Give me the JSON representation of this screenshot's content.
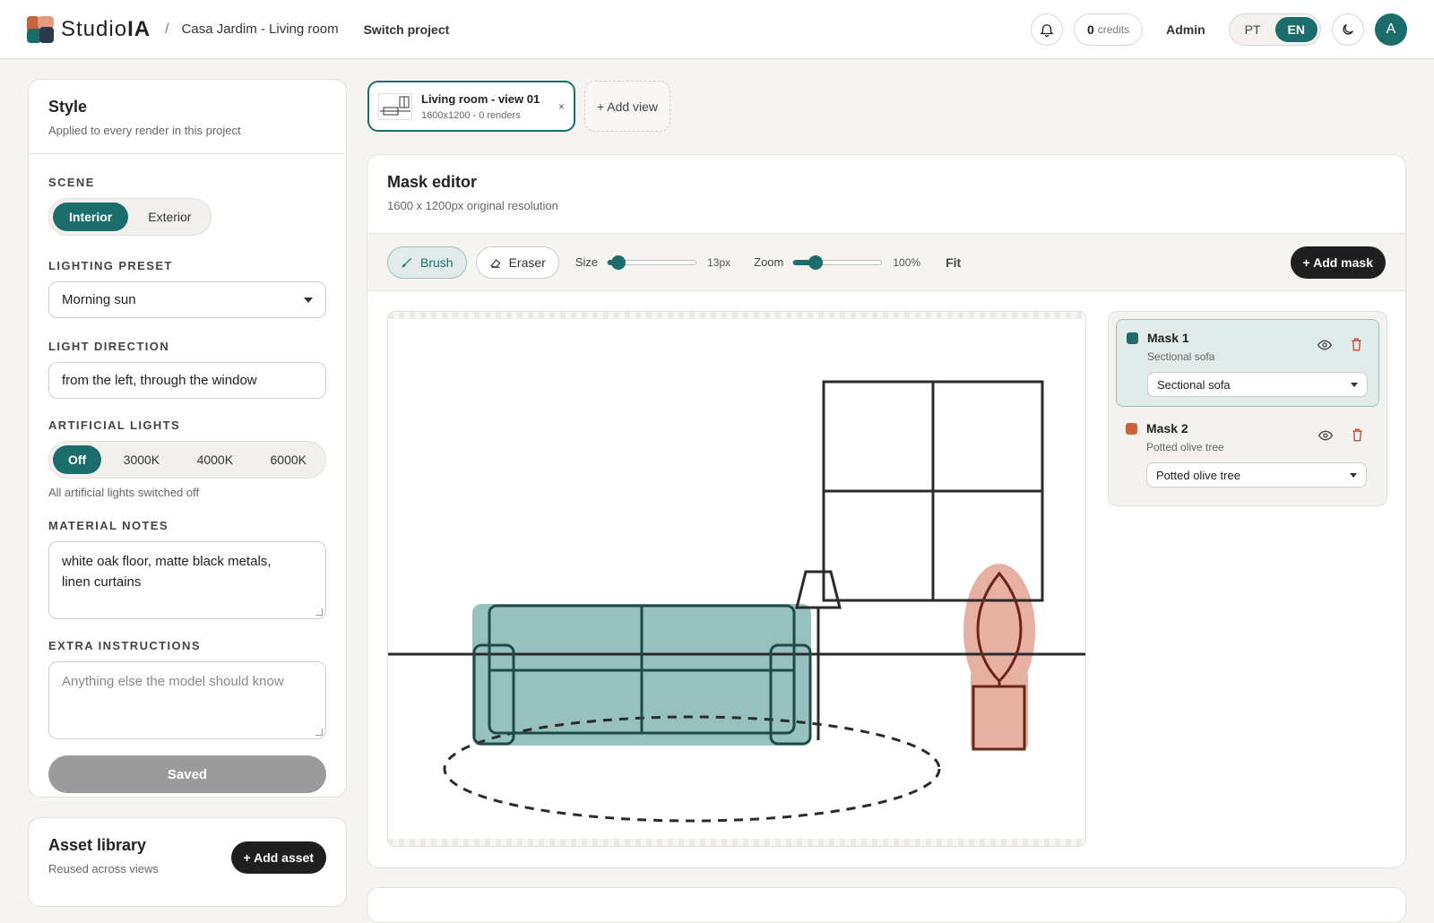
{
  "header": {
    "logo_text": "Studio",
    "logo_bold": "IA",
    "breadcrumb_sep": "/",
    "project_name": "Casa Jardim - Living room",
    "switch_project": "Switch project",
    "credits_value": "0",
    "credits_unit": "credits",
    "admin_label": "Admin",
    "lang_options": [
      "PT",
      "EN"
    ],
    "lang_selected": "EN",
    "avatar_initial": "A"
  },
  "style_panel": {
    "title": "Style",
    "subtitle": "Applied to every render in this project",
    "scene": {
      "label": "SCENE",
      "options": [
        "Interior",
        "Exterior"
      ],
      "selected": "Interior"
    },
    "lighting_preset": {
      "label": "LIGHTING PRESET",
      "value": "Morning sun"
    },
    "light_direction": {
      "label": "LIGHT DIRECTION",
      "value": "from the left, through the window"
    },
    "artificial_lights": {
      "label": "ARTIFICIAL LIGHTS",
      "options": [
        "Off",
        "3000K",
        "4000K",
        "6000K"
      ],
      "selected": "Off",
      "hint": "All artificial lights switched off"
    },
    "material_notes": {
      "label": "MATERIAL NOTES",
      "value_line1": "white oak floor, matte black metals,",
      "value_line2": "linen curtains"
    },
    "extra_instructions": {
      "label": "EXTRA INSTRUCTIONS",
      "placeholder": "Anything else the model should know"
    },
    "saved_button": "Saved"
  },
  "asset_library": {
    "title": "Asset library",
    "subtitle": "Reused across views",
    "add_button": "+ Add asset"
  },
  "views": {
    "tabs": [
      {
        "title": "Living room - view 01",
        "meta": "1600x1200 - 0 renders",
        "close": "×"
      }
    ],
    "add_view": "+ Add view"
  },
  "mask_editor": {
    "title": "Mask editor",
    "subtitle": "1600 x 1200px original resolution",
    "tools": {
      "brush": "Brush",
      "eraser": "Eraser",
      "active": "Brush"
    },
    "size": {
      "label": "Size",
      "value_text": "13px",
      "level": 0.12
    },
    "zoom": {
      "label": "Zoom",
      "value_text": "100%",
      "level": 0.25
    },
    "fit": "Fit",
    "add_mask": "+ Add mask",
    "masks": [
      {
        "name": "Mask 1",
        "description": "Sectional sofa",
        "selection": "Sectional sofa",
        "color": "#1b6d6b",
        "selected": true
      },
      {
        "name": "Mask 2",
        "description": "Potted olive tree",
        "selection": "Potted olive tree",
        "color": "#c9643f",
        "selected": false
      }
    ]
  },
  "colors": {
    "accent": "#1b6d6b",
    "mask_teal_fill": "#97c1bd",
    "mask_coral_fill": "#e6b0a3",
    "dark_button": "#1f1f1f"
  }
}
